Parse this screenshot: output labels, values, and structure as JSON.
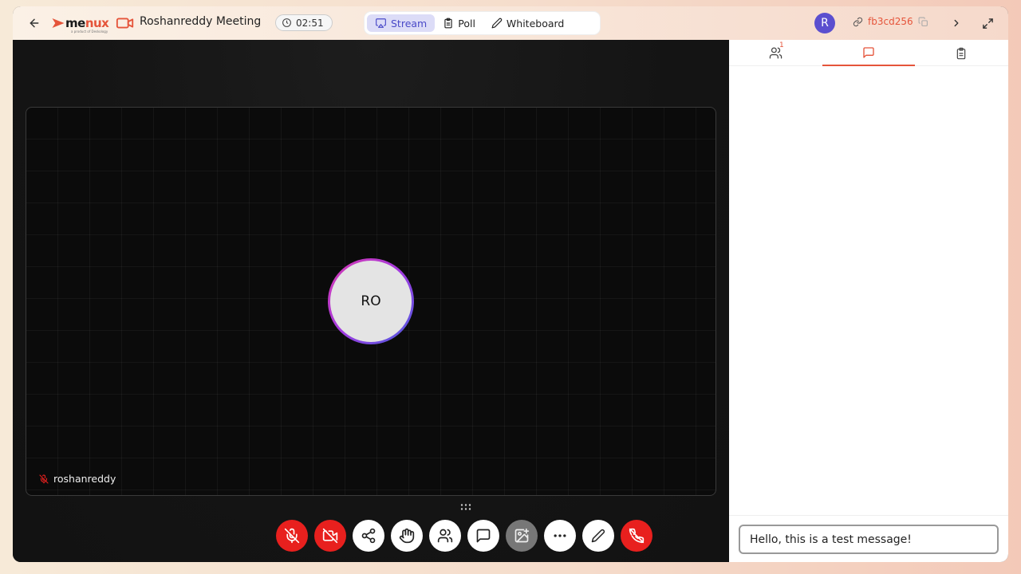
{
  "header": {
    "logo_main": "me",
    "logo_accent": "nux",
    "logo_sub": "a product of Deskology",
    "meeting_title": "Roshanreddy Meeting",
    "timer": "02:51",
    "tabs": [
      {
        "label": "Stream",
        "icon": "stream-icon",
        "active": true
      },
      {
        "label": "Poll",
        "icon": "clipboard-icon",
        "active": false
      },
      {
        "label": "Whiteboard",
        "icon": "pencil-icon",
        "active": false
      }
    ],
    "avatar_initial": "R",
    "meeting_id": "fb3cd256"
  },
  "stage": {
    "participant_initials": "RO",
    "participant_name": "roshanreddy",
    "participant_mic": "muted"
  },
  "controls": [
    {
      "name": "mic-toggle-button",
      "icon": "mic-off-icon",
      "state": "off"
    },
    {
      "name": "camera-toggle-button",
      "icon": "camera-off-icon",
      "state": "off"
    },
    {
      "name": "share-button",
      "icon": "share-icon"
    },
    {
      "name": "raise-hand-button",
      "icon": "hand-icon"
    },
    {
      "name": "participants-button",
      "icon": "users-icon"
    },
    {
      "name": "chat-button",
      "icon": "chat-icon"
    },
    {
      "name": "effects-button",
      "icon": "image-sparkle-icon",
      "state": "disabled"
    },
    {
      "name": "more-button",
      "icon": "more-icon"
    },
    {
      "name": "annotate-button",
      "icon": "pencil-icon"
    },
    {
      "name": "leave-button",
      "icon": "phone-off-icon"
    }
  ],
  "panel": {
    "tabs": [
      {
        "icon": "users-icon",
        "badge": "1",
        "active": false
      },
      {
        "icon": "chat-icon",
        "active": true
      },
      {
        "icon": "clipboard-icon",
        "active": false
      }
    ],
    "chat_input_value": "Hello, this is a test message!"
  },
  "colors": {
    "accent": "#e5543a",
    "stream_tab_bg": "#dcdcf7",
    "danger": "#e8201e",
    "avatar_bg": "#5b4fcf"
  }
}
